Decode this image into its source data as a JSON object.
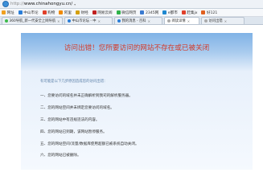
{
  "address_bar": {
    "scheme": "http://",
    "host": "www.chinahongyu.cn/"
  },
  "bookmarks": [
    {
      "label": "网址",
      "color": "#f0a020"
    },
    {
      "label": "中山市论",
      "color": "#2a7ed8"
    },
    {
      "label": "购物",
      "color": "#e0402a"
    },
    {
      "label": "阿里",
      "color": "#f08a00"
    },
    {
      "label": "财经",
      "color": "#d4a010"
    },
    {
      "label": "网易云阅",
      "color": "#c02020"
    },
    {
      "label": "微信网页",
      "color": "#2fb24a"
    },
    {
      "label": "2345网",
      "color": "#3a7ad0"
    },
    {
      "label": "e都市",
      "color": "#1e88d0"
    },
    {
      "label": "赶集jx",
      "color": "#e0402a"
    },
    {
      "label": "好121",
      "color": "#e06020"
    }
  ],
  "tabs": [
    {
      "label": "360导航_新一代安全上网导航",
      "color": "#3cba4a",
      "active": false
    },
    {
      "label": "中山市论坛 - 中",
      "color": "#2a7ed8",
      "active": false
    },
    {
      "label": "我的消息 - 百科",
      "color": "#2a7ed8",
      "active": false
    },
    {
      "label": "阅读详情",
      "color": "#aaaaaa",
      "active": true
    },
    {
      "label": "访问出错",
      "color": "#aaaaaa",
      "active": false
    }
  ],
  "error": {
    "heading": "访问出错！您所要访问的网站不存在或已被关闭",
    "subheading": "有可能是以下几步原因造成您的访问出错：",
    "reasons": [
      "一、您要访问的域名并未正确解析到我司的解析服务器。",
      "二、您的网站空间并未绑定您要访问的域名。",
      "三、您的网站中有违规违法的内容。",
      "四、您的网站已到期，该网站暂停服务。",
      "五、您的网站空间/流量/数据库使用超额已被系统自动关闭。",
      "六、您的网站已被删除。"
    ]
  }
}
